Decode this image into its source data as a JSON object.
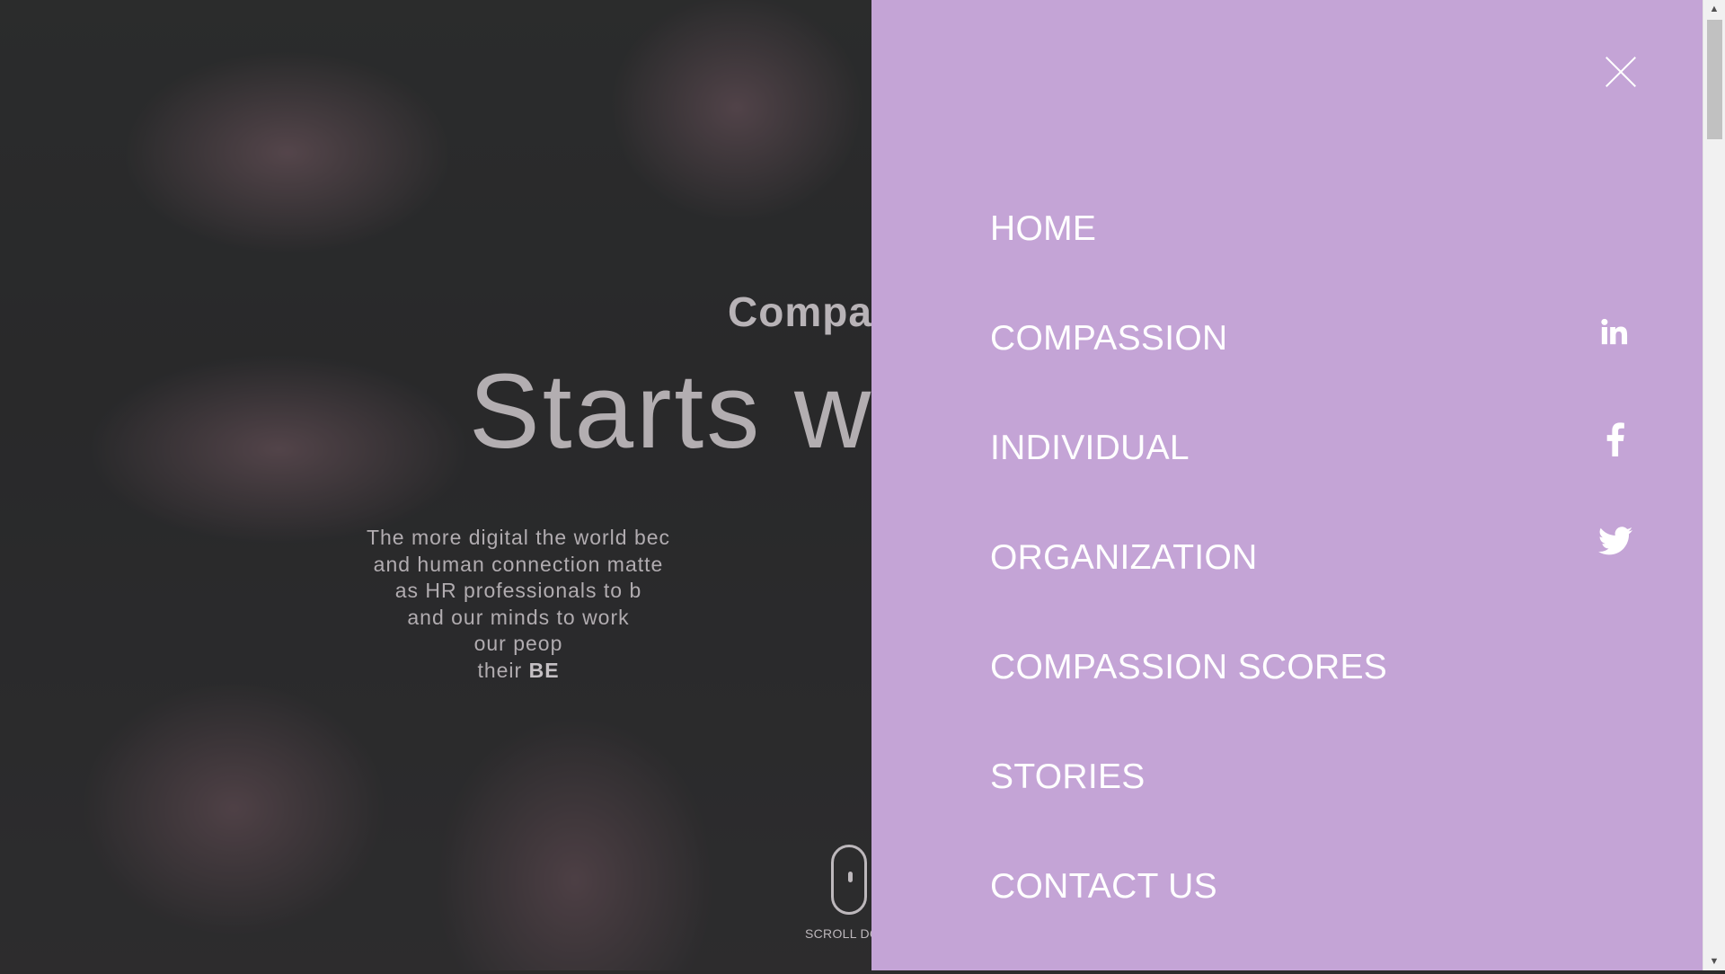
{
  "hero": {
    "eyebrow": "Compas",
    "title": "Starts w",
    "body_lines": [
      "The more digital the world bec",
      "and human connection matte",
      "as HR professionals to b",
      "and our minds to work",
      "our peop"
    ],
    "body_last_prefix": "their ",
    "body_last_bold": "BE",
    "scroll_label": "SCROLL DO"
  },
  "menu": {
    "close_icon": "close-icon",
    "items": [
      {
        "label": "HOME"
      },
      {
        "label": "COMPASSION"
      },
      {
        "label": "INDIVIDUAL"
      },
      {
        "label": "ORGANIZATION"
      },
      {
        "label": "COMPASSION SCORES"
      },
      {
        "label": "STORIES"
      },
      {
        "label": "CONTACT US"
      }
    ],
    "social": [
      {
        "name": "linkedin-icon"
      },
      {
        "name": "facebook-icon"
      },
      {
        "name": "twitter-icon"
      }
    ]
  },
  "colors": {
    "menu_background": "#c4a4d6",
    "menu_text": "#ffffff",
    "hero_overlay": "#2a2430"
  }
}
